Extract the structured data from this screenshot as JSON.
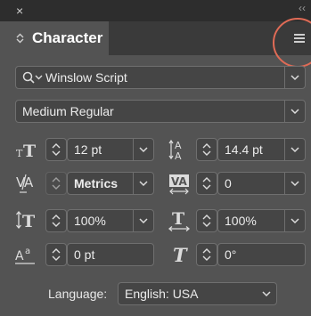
{
  "window": {
    "close_glyph": "×",
    "collapse_glyph": "‹‹"
  },
  "panel": {
    "title": "Character",
    "menu_icon": "hamburger-menu-icon",
    "highlight_color": "#e06b56"
  },
  "font_family": {
    "value": "Winslow Script"
  },
  "font_style": {
    "value": "Medium Regular"
  },
  "font_size": {
    "value": "12 pt"
  },
  "leading": {
    "value": "14.4 pt"
  },
  "kerning": {
    "value": "Metrics"
  },
  "tracking": {
    "value": "0"
  },
  "vertical_scale": {
    "value": "100%"
  },
  "horizontal_scale": {
    "value": "100%"
  },
  "baseline_shift": {
    "value": "0 pt"
  },
  "skew": {
    "value": "0°"
  },
  "language": {
    "label": "Language:",
    "value": "English: USA"
  }
}
